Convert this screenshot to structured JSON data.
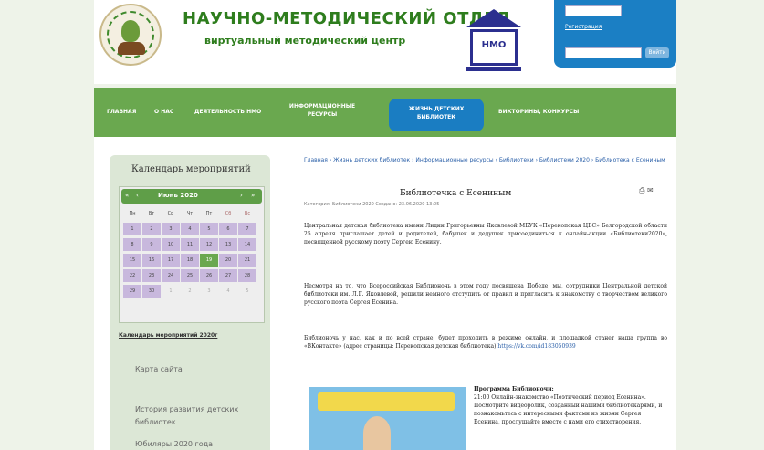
{
  "header": {
    "title": "НАУЧНО-МЕТОДИЧЕСКИЙ ОТДЕЛ",
    "subtitle": "виртуальный методический центр",
    "nmo_label": "НМО",
    "login": {
      "link": "Регистрация",
      "button": "Войти"
    }
  },
  "nav": {
    "items": [
      "ГЛАВНАЯ",
      "О НАС",
      "ДЕЯТЕЛЬНОСТЬ НМО"
    ],
    "item_resources": "ИНФОРМАЦИОННЫЕ РЕСУРСЫ",
    "active": "ЖИЗНЬ ДЕТСКИХ БИБЛИОТЕК",
    "item_last": "ВИКТОРИНЫ, КОНКУРСЫ"
  },
  "sidebar": {
    "calendar_title": "Календарь мероприятий",
    "month": "Июнь 2020",
    "weekdays": [
      "Пн",
      "Вт",
      "Ср",
      "Чт",
      "Пт",
      "Сб",
      "Вс"
    ],
    "days": [
      [
        "1",
        "2",
        "3",
        "4",
        "5",
        "6",
        "7"
      ],
      [
        "8",
        "9",
        "10",
        "11",
        "12",
        "13",
        "14"
      ],
      [
        "15",
        "16",
        "17",
        "18",
        "19",
        "20",
        "21"
      ],
      [
        "22",
        "23",
        "24",
        "25",
        "26",
        "27",
        "28"
      ],
      [
        "29",
        "30",
        "1",
        "2",
        "3",
        "4",
        "5"
      ]
    ],
    "calendar_link": "Календарь мероприятий 2020г",
    "links": [
      "Карта сайта",
      "История развития детских библиотек",
      "Юбиляры 2020 года"
    ]
  },
  "article": {
    "breadcrumbs": "Главная › Жизнь детских библиотек › Информационные ресурсы › Библиотеки › Библиотеки 2020 › Библиотека с Есениным",
    "title": "Библиотечка с Есениным",
    "meta": "Категория: Библиотеки 2020   Создано: 23.06.2020 13:05",
    "p1": "Центральная детская библиотека имени Лидии Григорьевны Яковлевой МБУК «Перекопская ЦБС» Белгородской области 25 апреля приглашает детей и родителей, бабушек и дедушек присоединиться к онлайн-акции «Библиотеки2020», посвященной русскому поэту Сергею Есенину.",
    "p2": "Несмотря на то, что Всероссийская Библионочь в этом году посвящена Победе, мы, сотрудники Центральной детской библиотеки им. Л.Г. Яковлевой, решили немного отступить от правил и пригласить к знакомству с творчеством великого русского поэта Сергея Есенина.",
    "p3_text": "Библионочь у нас, как и по всей стране, будет проходить в режиме онлайн, и площадкой станет наша группа во «ВКонтакте» (адрес страницы: Перекопская детская библиотека)",
    "p3_link": "https://vk.com/id183050939",
    "side_heading": "Программа Библионочи:",
    "side_text": "21:00 Онлайн-знакомство «Поэтический период Есенина». Посмотрите видеоролик, созданный нашими библиотекарями, и познакомьтесь с интересными фактами из жизни Сергея Есенина, прослушайте вместе с нами его стихотворения."
  },
  "colors": {
    "green": "#6aa84f",
    "blue": "#1a7dc2",
    "title_green": "#2e7d1d"
  }
}
